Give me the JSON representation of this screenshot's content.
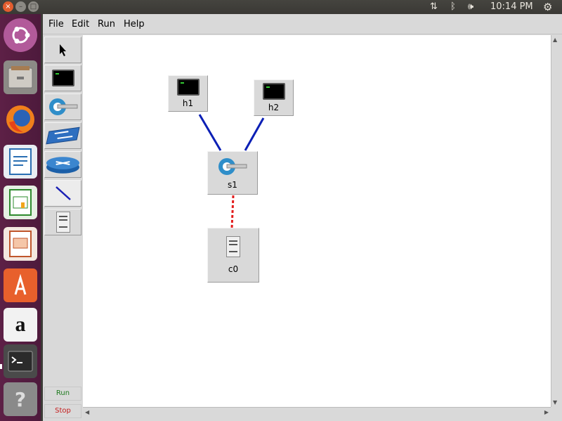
{
  "tray": {
    "time": "10:14 PM"
  },
  "menu": {
    "file": "File",
    "edit": "Edit",
    "run": "Run",
    "help": "Help"
  },
  "toolbar": {
    "run_label": "Run",
    "stop_label": "Stop"
  },
  "nodes": {
    "h1": "h1",
    "h2": "h2",
    "s1": "s1",
    "c0": "c0"
  },
  "colors": {
    "host_link": "#0b1fb5",
    "controller_link": "#e21b1b",
    "run_text": "#1d7a1d",
    "stop_text": "#c41d1d"
  }
}
